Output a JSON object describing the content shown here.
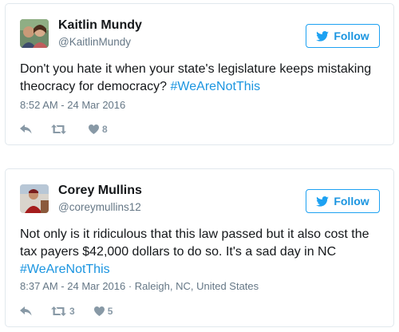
{
  "colors": {
    "link": "#1b95e0",
    "follow_border": "#1da1f2",
    "meta": "#657786",
    "action_icon": "#8899a6",
    "border": "#e1e8ed"
  },
  "tweets": [
    {
      "name": "Kaitlin Mundy",
      "handle": "@KaitlinMundy",
      "follow_label": "Follow",
      "text_plain": "Don't you hate it when your state's legislature keeps mistaking theocracy for democracy? ",
      "hashtag": "#WeAreNotThis",
      "meta": "8:52 AM - 24 Mar 2016",
      "retweets": "",
      "likes": "8",
      "icons": [
        "reply-icon",
        "retweet-icon",
        "heart-icon"
      ]
    },
    {
      "name": "Corey Mullins",
      "handle": "@coreymullins12",
      "follow_label": "Follow",
      "text_plain": "Not only is it ridiculous that this law passed but it also cost the tax payers $42,000 dollars to do so. It's a sad day in NC ",
      "hashtag": "#WeAreNotThis",
      "meta": "8:37 AM - 24 Mar 2016 · Raleigh, NC, United States",
      "retweets": "3",
      "likes": "5",
      "icons": [
        "reply-icon",
        "retweet-icon",
        "heart-icon"
      ]
    }
  ]
}
